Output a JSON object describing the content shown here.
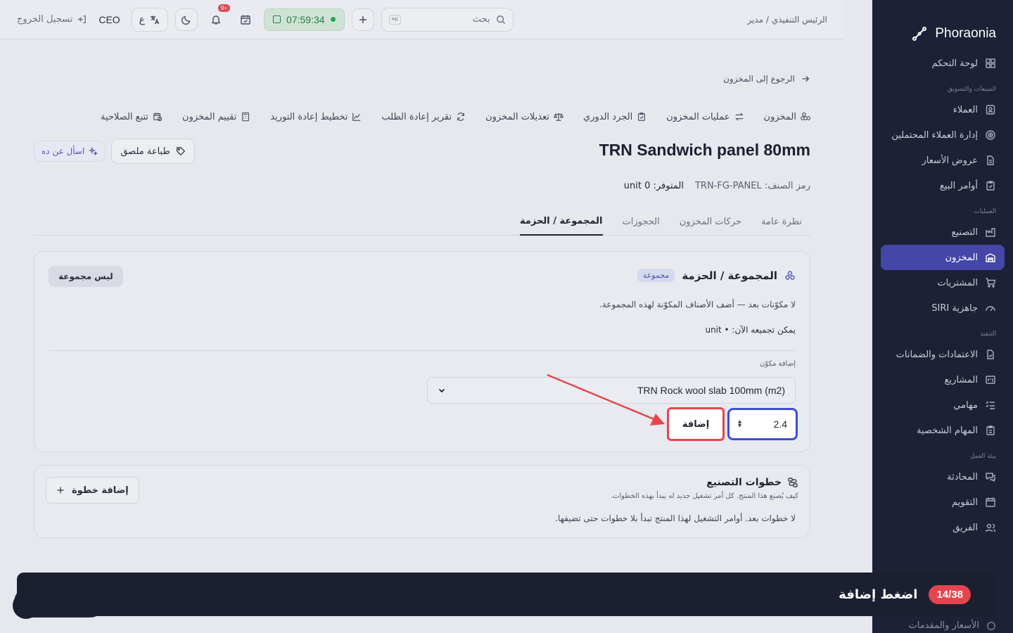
{
  "app": {
    "brand": "Phoraonia"
  },
  "sidebar": {
    "items": [
      {
        "label": "لوحة التحكم"
      },
      {
        "section": "المبيعات والتسويق"
      },
      {
        "label": "العملاء"
      },
      {
        "label": "إدارة العملاء المحتملين"
      },
      {
        "label": "عروض الأسعار"
      },
      {
        "label": "أوامر البيع"
      },
      {
        "section": "العمليات"
      },
      {
        "label": "التصنيع"
      },
      {
        "label": "المخزون",
        "active": true
      },
      {
        "label": "المشتريات"
      },
      {
        "label": "جاهزية SIRI"
      },
      {
        "section": "التنفيذ"
      },
      {
        "label": "الاعتمادات والضمانات"
      },
      {
        "label": "المشاريع"
      },
      {
        "label": "مهامي"
      },
      {
        "label": "المهام الشخصية"
      },
      {
        "section": "بيئة العمل"
      },
      {
        "label": "المحادثة"
      },
      {
        "label": "التقويم"
      },
      {
        "label": "الفريق"
      }
    ],
    "peek_label": "الأسعار والمقدمات"
  },
  "topbar": {
    "breadcrumb": "الرئيس التنفيذي / مدير",
    "search_placeholder": "بحث",
    "search_kbd": "K⌘",
    "timer": "07:59:34",
    "notif_count": "+9",
    "lang_letter": "ع",
    "role": "CEO",
    "logout": "تسجيل الخروج"
  },
  "page": {
    "back": "الرجوع إلى المخزون",
    "subnav": [
      "المخزون",
      "عمليات المخزون",
      "الجرد الدوري",
      "تعديلات المخزون",
      "تقرير إعادة الطلب",
      "تخطيط إعادة التوريد",
      "تقييم المخزون",
      "تتبع الصلاحية"
    ],
    "title": "TRN Sandwich panel 80mm",
    "print_label": "طباعة ملصق",
    "ask_label": "اسأل عن ده",
    "code": "رمز الصنف: TRN-FG-PANEL",
    "available": "المتوفر: 0 unit",
    "tabs": [
      "نظرة عامة",
      "حركات المخزون",
      "الحجوزات",
      "المجموعة / الحزمة"
    ]
  },
  "bundle": {
    "title": "المجموعة / الحزمة",
    "chip": "مجموعة",
    "not_group": "ليس مجموعة",
    "empty_note": "لا مكوّنات بعد — أضف الأصناف المكوّنة لهذه المجموعة.",
    "can_assemble": "يمكن تجميعه الآن: • unit",
    "add_component_label": "إضافة مكوّن",
    "selected_component": "TRN Rock wool slab 100mm (m2)",
    "quantity": "2.4",
    "add_button": "إضافة"
  },
  "steps": {
    "title": "خطوات التصنيع",
    "subtitle": "كيف يُصنع هذا المنتج. كل أمر تشغيل جديد له يبدأ بهذه الخطوات.",
    "empty": "لا خطوات بعد. أوامر التشغيل لهذا المنتج تبدأ بلا خطوات حتى تضيفها.",
    "add_step": "إضافة خطوة"
  },
  "tour": {
    "counter": "14/38",
    "instruction": "اضغط إضافة"
  },
  "colors": {
    "sidebar_bg": "#1d2135",
    "accent": "#4446a8",
    "highlight": "#e8444c",
    "focus": "#3b4fd8"
  }
}
